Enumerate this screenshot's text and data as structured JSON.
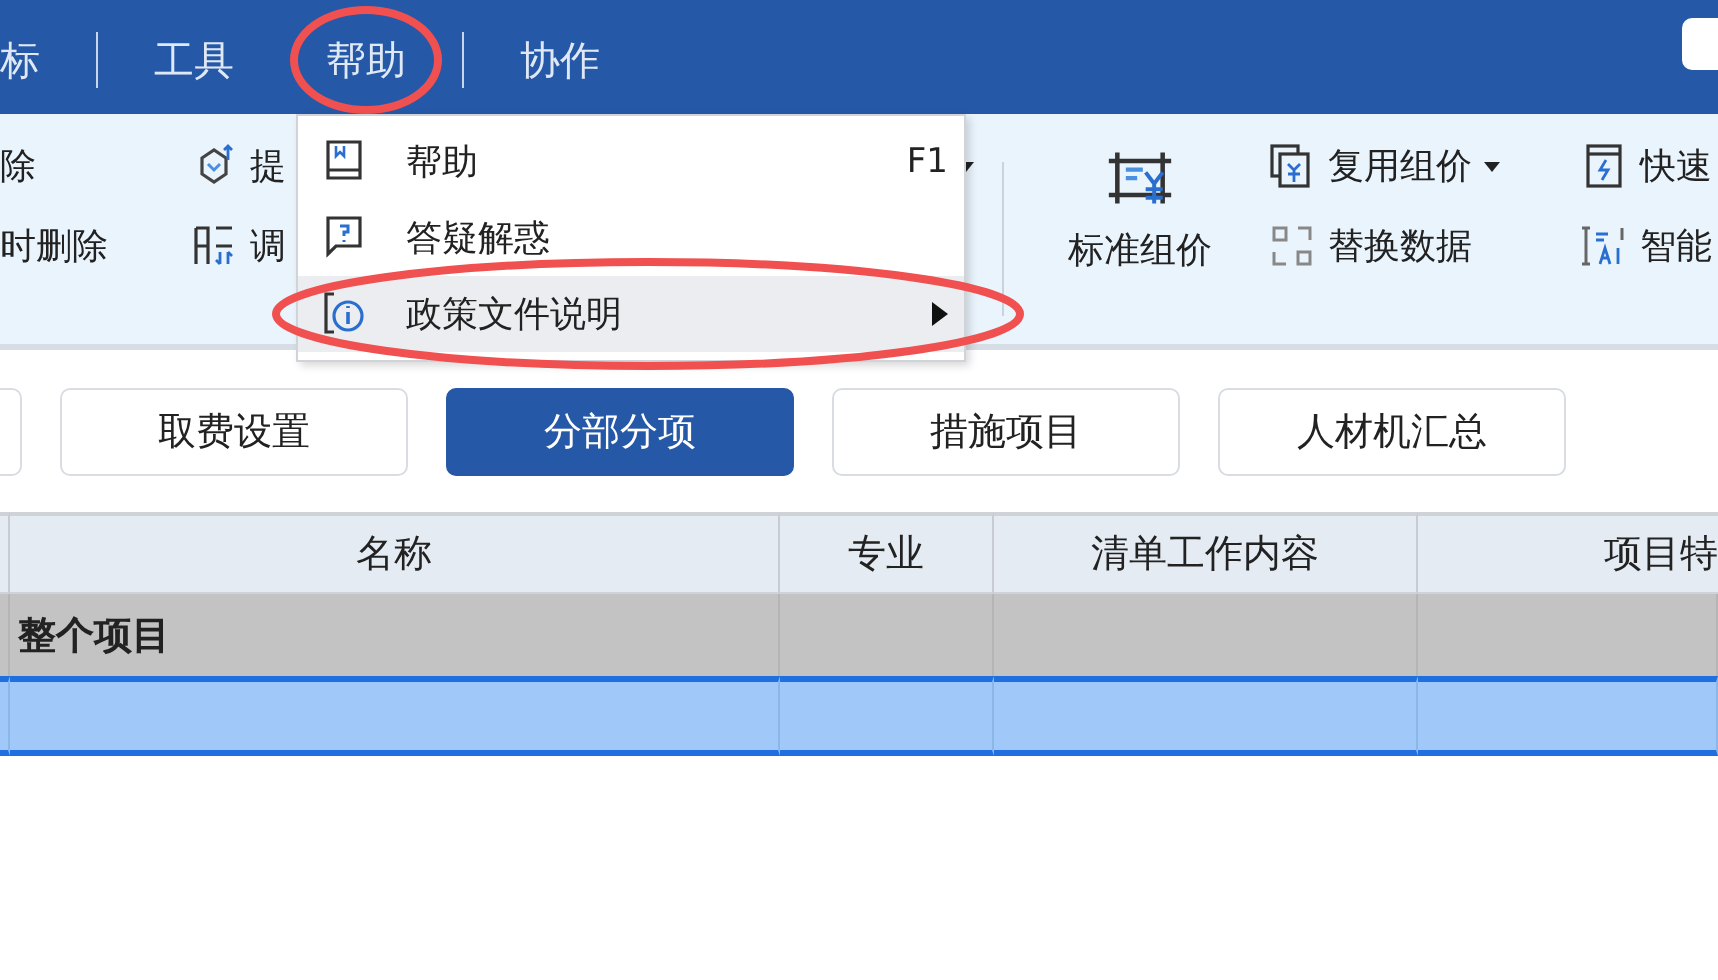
{
  "menu_bar": {
    "items": [
      {
        "kind": "item",
        "label": "标",
        "circled": false
      },
      {
        "kind": "divider"
      },
      {
        "kind": "item",
        "label": "工具",
        "circled": false
      },
      {
        "kind": "item",
        "label": "帮助",
        "circled": true
      },
      {
        "kind": "divider"
      },
      {
        "kind": "item",
        "label": "协作",
        "circled": false
      }
    ]
  },
  "ribbon": {
    "columns": [
      {
        "kind": "small",
        "items": [
          {
            "label": "除",
            "caret": false
          },
          {
            "label": "时删除",
            "caret": false
          }
        ]
      },
      {
        "kind": "small",
        "items": [
          {
            "label": "提",
            "caret": true
          },
          {
            "label": "调",
            "caret": false
          }
        ]
      },
      {
        "kind": "large",
        "items": [
          {
            "label": "标准组价",
            "caret": false
          }
        ]
      },
      {
        "kind": "small",
        "items": [
          {
            "label": "复用组价",
            "caret": true
          },
          {
            "label": "替换数据",
            "caret": false
          }
        ]
      },
      {
        "kind": "small",
        "items": [
          {
            "label": "快速",
            "caret": false
          },
          {
            "label": "智能",
            "caret": false
          }
        ]
      }
    ]
  },
  "dropdown": {
    "items": [
      {
        "label": "帮助",
        "shortcut": "F1",
        "highlighted": false,
        "submenu": false,
        "circled": false
      },
      {
        "label": "答疑解惑",
        "highlighted": false,
        "submenu": false,
        "circled": false
      },
      {
        "label": "政策文件说明",
        "highlighted": true,
        "submenu": true,
        "circled": true
      }
    ]
  },
  "tabs": [
    {
      "label": "取费设置",
      "selected": false
    },
    {
      "label": "分部分项",
      "selected": true
    },
    {
      "label": "措施项目",
      "selected": false
    },
    {
      "label": "人材机汇总",
      "selected": false
    }
  ],
  "table": {
    "columns": [
      "名称",
      "专业",
      "清单工作内容",
      "项目特"
    ],
    "rows": [
      {
        "kind": "group",
        "selected": false,
        "cells": [
          "整个项目"
        ]
      },
      {
        "kind": "item",
        "selected": true,
        "cells": []
      }
    ]
  }
}
